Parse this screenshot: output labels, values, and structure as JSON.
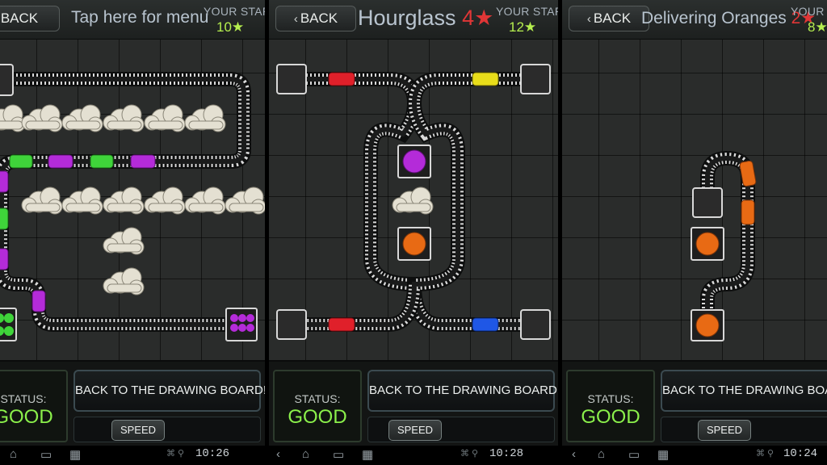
{
  "panels": [
    {
      "back_label": "BACK",
      "title": "Tap here for menu",
      "stars_label": "YOUR STARS",
      "stars_count": "10",
      "status_label": "STATUS:",
      "status_value": "GOOD",
      "drawing_board_label": "BACK TO THE DRAWING BOARD!",
      "speed_label": "SPEED"
    },
    {
      "back_label": "BACK",
      "title": "Hourglass",
      "level_number": "4",
      "stars_label": "YOUR STARS",
      "stars_count": "12",
      "status_label": "STATUS:",
      "status_value": "GOOD",
      "drawing_board_label": "BACK TO THE DRAWING BOARD!",
      "speed_label": "SPEED"
    },
    {
      "back_label": "BACK",
      "title": "Delivering Oranges",
      "level_number": "2",
      "stars_label": "YOUR STARS",
      "stars_count": "8",
      "status_label": "STATUS:",
      "status_value": "GOOD",
      "drawing_board_label": "BACK TO THE DRAWING BOARD!",
      "speed_label": "SPEED"
    }
  ],
  "system_bar": {
    "time_1": "10:26",
    "time_2": "10:28",
    "time_3": "10:24"
  },
  "icons": [
    "back-nav-icon",
    "home-icon",
    "recent-apps-icon",
    "screenshot-icon",
    "usb-icon",
    "star-icon",
    "chevron-left-icon",
    "storm-cloud",
    "train-car",
    "station-tile"
  ],
  "colors": {
    "stars_green": "#b5ee4e",
    "status_green": "#8bf04b",
    "level_red": "#e03636",
    "train_green": "#3fd43a",
    "train_purple": "#b42bd9",
    "train_red": "#e0202a",
    "train_yellow": "#e8dd1a",
    "train_blue": "#1f57e6",
    "train_orange": "#e86a14"
  }
}
